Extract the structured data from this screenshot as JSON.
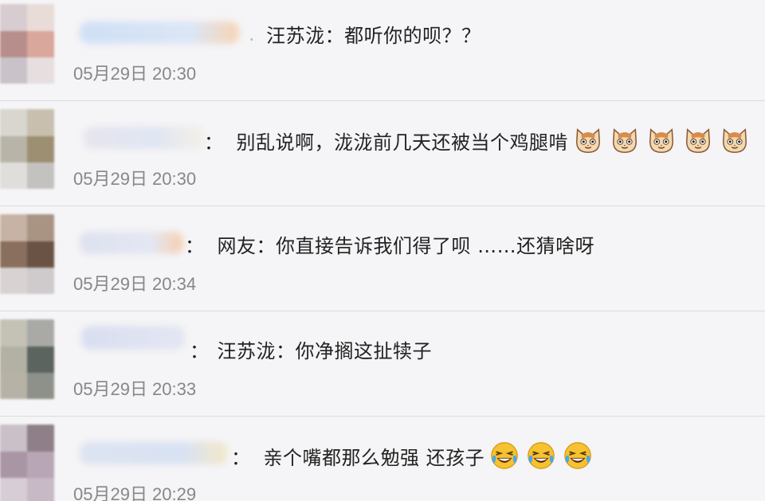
{
  "comments": [
    {
      "text": "汪苏泷：都听你的呗？？",
      "time": "05月29日 20:30",
      "emojis": [],
      "emoji_icon": ""
    },
    {
      "text": "别乱说啊，泷泷前几天还被当个鸡腿啃",
      "prefix": "：",
      "time": "05月29日 20:30",
      "emojis": [
        "cat",
        "cat",
        "cat",
        "cat",
        "cat"
      ],
      "emoji_icon": "cat-face-icon"
    },
    {
      "text": "网友：你直接告诉我们得了呗 ……还猜啥呀",
      "prefix": "：",
      "time": "05月29日 20:34",
      "emojis": [],
      "emoji_icon": ""
    },
    {
      "text": "汪苏泷：你净搁这扯犊子",
      "prefix": "：",
      "time": "05月29日 20:33",
      "emojis": [],
      "emoji_icon": ""
    },
    {
      "text": "亲个嘴都那么勉强 还孩子",
      "prefix": "：",
      "time": "05月29日 20:29",
      "emojis": [
        "laugh",
        "laugh",
        "laugh"
      ],
      "emoji_icon": "laughing-crying-face-icon"
    }
  ],
  "colors": {
    "background": "#f5f4f6",
    "text": "#222222",
    "time": "#878787",
    "divider": "#dcdadd"
  }
}
